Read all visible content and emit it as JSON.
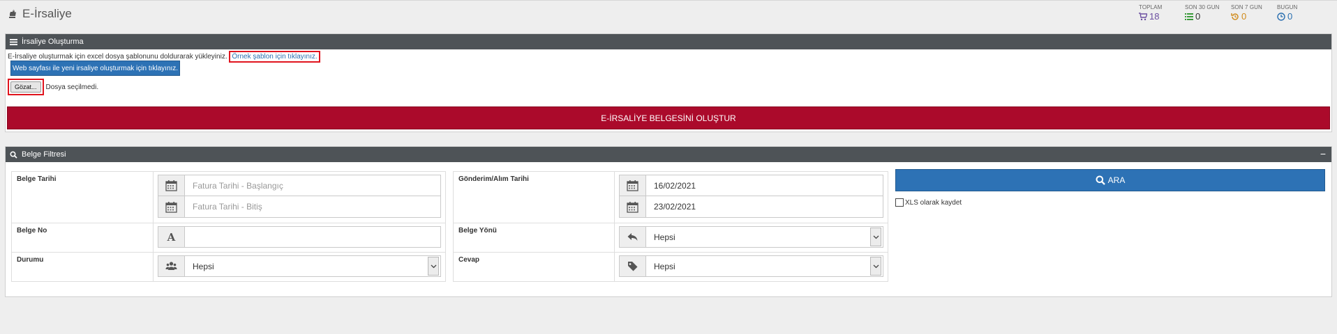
{
  "header": {
    "title": "E-İrsaliye"
  },
  "stats": [
    {
      "label": "TOPLAM",
      "value": "18",
      "icon": "cart-icon",
      "color": "#6b4ea0"
    },
    {
      "label": "SON 30 GUN",
      "value": "0",
      "icon": "list-icon",
      "color": "#3a9a3a"
    },
    {
      "label": "SON 7 GUN",
      "value": "0",
      "icon": "history-icon",
      "color": "#d08a1a"
    },
    {
      "label": "BUGUN",
      "value": "0",
      "icon": "clock-icon",
      "color": "#2a6fb0"
    }
  ],
  "create_panel": {
    "title": "İrsaliye Oluşturma",
    "hint_text": "E-İrsaliye oluşturmak için excel dosya şablonunu doldurarak yükleyiniz.",
    "template_link": "Örnek şablon için tıklayınız.",
    "web_button": "Web sayfası ile yeni irsaliye oluşturmak için tıklayınız.",
    "browse_button": "Gözat...",
    "no_file_text": "Dosya seçilmedi.",
    "create_button": "E-İRSALİYE BELGESİNİ OLUŞTUR"
  },
  "filter_panel": {
    "title": "Belge Filtresi",
    "belge_tarihi": {
      "label": "Belge Tarihi",
      "start_placeholder": "Fatura Tarihi - Başlangıç",
      "end_placeholder": "Fatura Tarihi - Bitiş"
    },
    "belge_no": {
      "label": "Belge No",
      "value": ""
    },
    "durumu": {
      "label": "Durumu",
      "value": "Hepsi"
    },
    "gonderim_tarihi": {
      "label": "Gönderim/Alım Tarihi",
      "start": "16/02/2021",
      "end": "23/02/2021"
    },
    "belge_yonu": {
      "label": "Belge Yönü",
      "value": "Hepsi"
    },
    "cevap": {
      "label": "Cevap",
      "value": "Hepsi"
    },
    "search_button": "ARA",
    "xls_label": "XLS olarak kaydet"
  },
  "colors": {
    "header_bar": "#4e5357",
    "primary": "#2d72b5",
    "danger": "#ab0a2b"
  }
}
